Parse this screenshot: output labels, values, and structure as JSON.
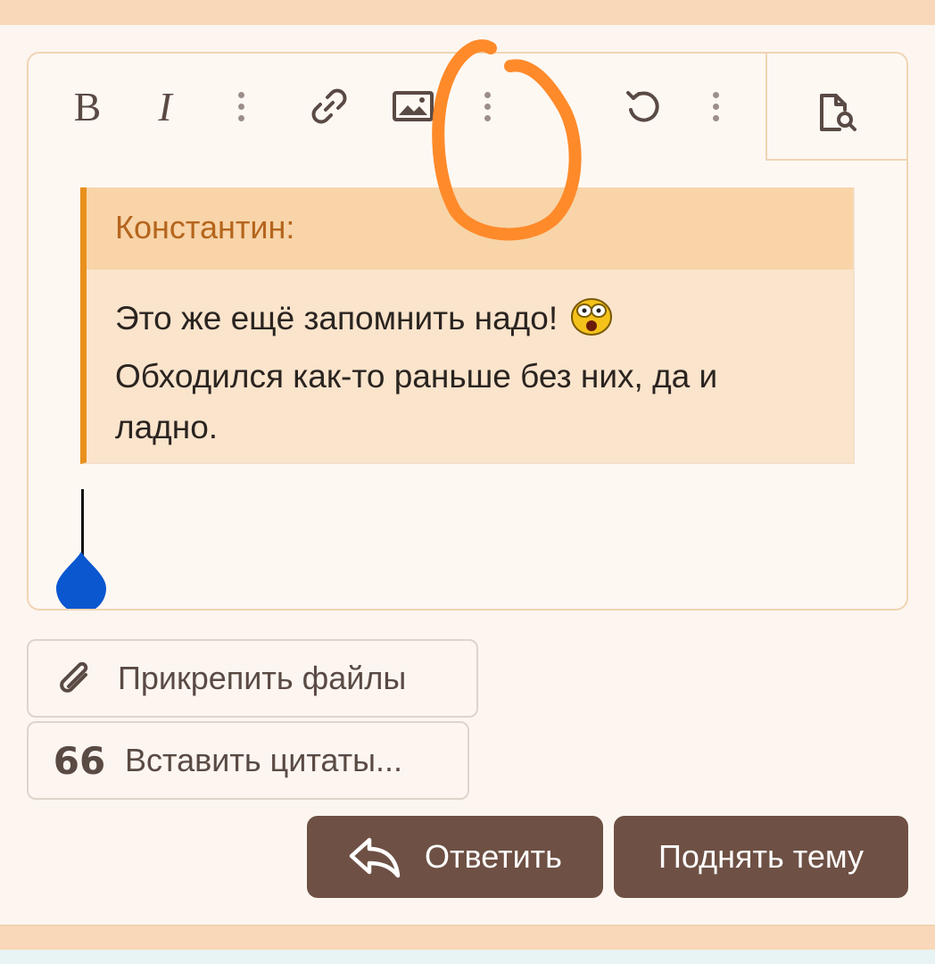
{
  "editor": {
    "toolbar": {
      "bold_label": "B",
      "italic_label": "I",
      "items": [
        "bold",
        "italic",
        "more-text-options",
        "link",
        "image",
        "more-insert-options",
        "undo",
        "more-options"
      ],
      "preview_icon": "document-search-icon"
    },
    "quote": {
      "author": "Константин:",
      "lines": [
        "Это же ещё запомнить надо!",
        "Обходился как-то раньше без них, да и",
        "ладно."
      ],
      "emoji": "shocked-emoji"
    }
  },
  "actions": {
    "attach_label": "Прикрепить файлы",
    "insert_quotes_label": "Вставить цитаты...",
    "insert_quotes_icon": "66",
    "reply_label": "Ответить",
    "bump_label": "Поднять тему"
  },
  "colors": {
    "accent": "#e8901c",
    "quote_header": "#f8d4a8",
    "quote_body": "#fbe4cc",
    "button": "#6e5044",
    "annotation": "#ff8a2a",
    "caret_handle": "#0b57d0"
  }
}
